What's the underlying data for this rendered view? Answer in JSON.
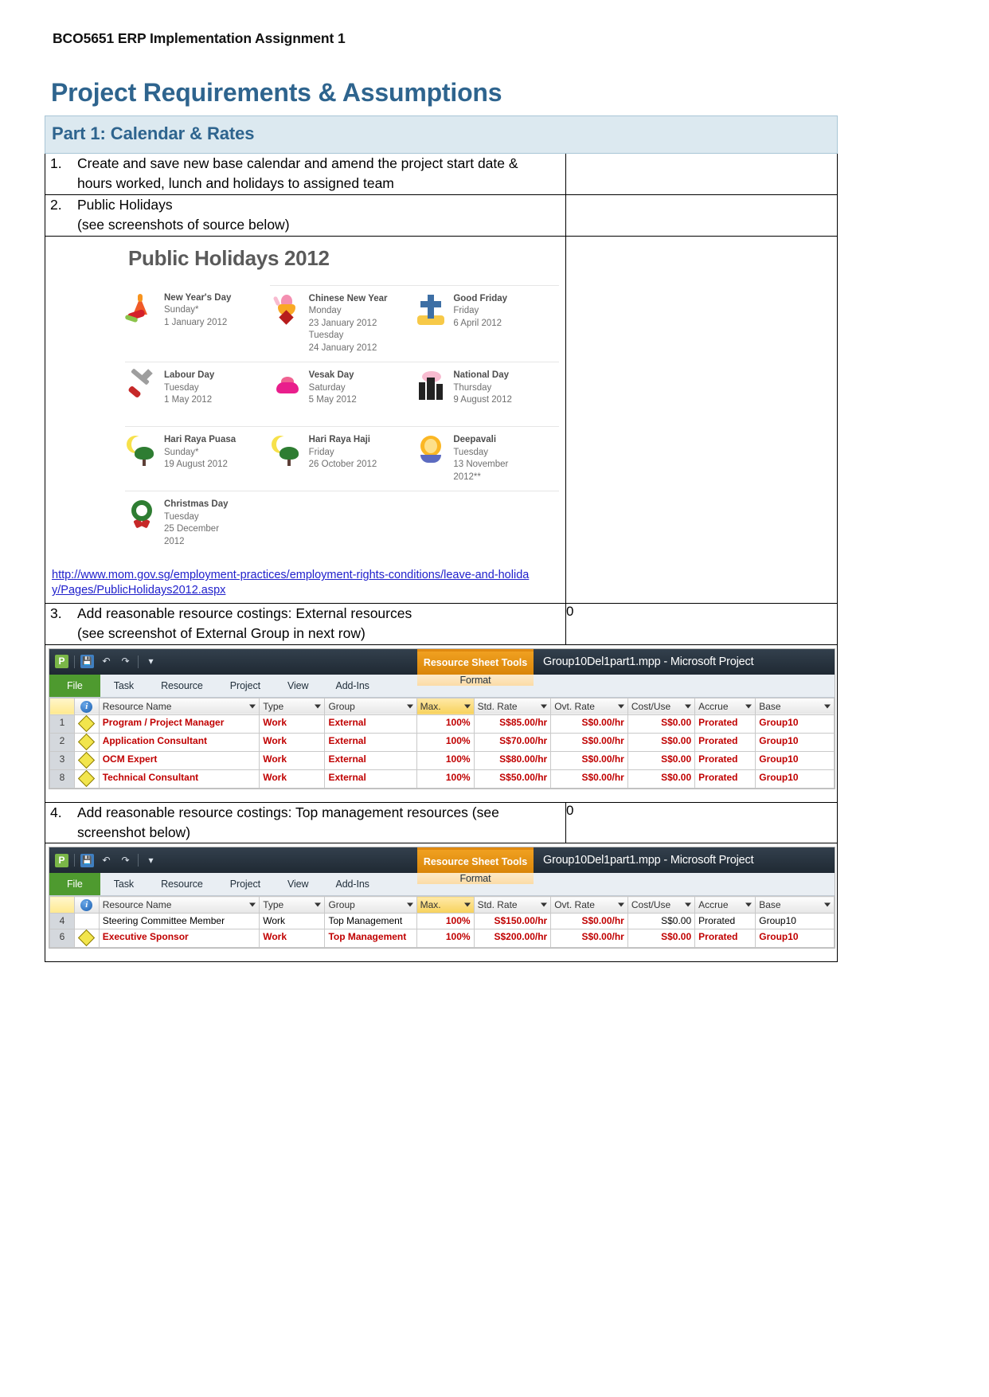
{
  "document": {
    "header": "BCO5651 ERP Implementation Assignment 1",
    "title": "Project Requirements & Assumptions",
    "section_band": "Part 1: Calendar & Rates"
  },
  "requirements": [
    {
      "num": "1.",
      "line1": "Create and save new base calendar and amend the project start date &",
      "line2": "hours worked, lunch and holidays to assigned team",
      "answer": ""
    },
    {
      "num": "2.",
      "line1": "Public Holidays",
      "line2": "(see screenshots of source below)",
      "answer": ""
    },
    {
      "num": "3.",
      "line1": "Add reasonable resource costings: External resources",
      "line2": "(see screenshot of External Group in next row)",
      "answer": "0"
    },
    {
      "num": "4.",
      "line1": "Add reasonable resource costings: Top management resources (see",
      "line2": "screenshot below)",
      "answer": "0"
    }
  ],
  "public_holidays": {
    "heading": "Public Holidays 2012",
    "source_url": "http://www.mom.gov.sg/employment-practices/employment-rights-conditions/leave-and-holiday/Pages/PublicHolidays2012.aspx",
    "items": [
      {
        "name": "New Year's Day",
        "icon": "firecracker-icon",
        "lines": [
          "Sunday*",
          "1 January 2012"
        ]
      },
      {
        "name": "Chinese New Year",
        "icon": "pineapple-icon",
        "lines": [
          "Monday",
          "23 January 2012",
          "Tuesday",
          "24 January 2012"
        ]
      },
      {
        "name": "Good Friday",
        "icon": "cross-icon",
        "lines": [
          "Friday",
          "6 April 2012"
        ]
      },
      {
        "name": "Labour Day",
        "icon": "hammer-icon",
        "lines": [
          "Tuesday",
          "1 May 2012"
        ]
      },
      {
        "name": "Vesak Day",
        "icon": "lotus-icon",
        "lines": [
          "Saturday",
          "5 May 2012"
        ]
      },
      {
        "name": "National Day",
        "icon": "cityscape-icon",
        "lines": [
          "Thursday",
          "9 August 2012"
        ]
      },
      {
        "name": "Hari Raya Puasa",
        "icon": "crescent-icon",
        "lines": [
          "Sunday*",
          "19 August 2012"
        ]
      },
      {
        "name": "Hari Raya Haji",
        "icon": "crescent-icon",
        "lines": [
          "Friday",
          "26 October 2012"
        ]
      },
      {
        "name": "Deepavali",
        "icon": "oil-lamp-icon",
        "lines": [
          "Tuesday",
          "13 November",
          "2012**"
        ]
      },
      {
        "name": "Christmas Day",
        "icon": "wreath-icon",
        "lines": [
          "Tuesday",
          "25 December",
          "2012"
        ]
      }
    ]
  },
  "msproject": {
    "quick_access": [
      "project-logo-icon",
      "save-icon",
      "undo-icon",
      "redo-icon",
      "customize-qat-icon"
    ],
    "context_tab_title": "Resource Sheet Tools",
    "document_title": "Group10Del1part1.mpp  -  Microsoft Project",
    "ribbon_tabs": [
      "File",
      "Task",
      "Resource",
      "Project",
      "View",
      "Add-Ins"
    ],
    "contextual_ribbon_tab": "Format",
    "columns": [
      "Resource Name",
      "Type",
      "Group",
      "Max.",
      "Std. Rate",
      "Ovt. Rate",
      "Cost/Use",
      "Accrue",
      "Base"
    ],
    "external_rows": [
      {
        "id": "1",
        "indicator": "warning-icon",
        "name": "Program / Project Manager",
        "type": "Work",
        "group": "External",
        "max": "100%",
        "std_rate": "S$85.00/hr",
        "ovt_rate": "S$0.00/hr",
        "cost_use": "S$0.00",
        "accrue": "Prorated",
        "base": "Group10"
      },
      {
        "id": "2",
        "indicator": "warning-icon",
        "name": "Application Consultant",
        "type": "Work",
        "group": "External",
        "max": "100%",
        "std_rate": "S$70.00/hr",
        "ovt_rate": "S$0.00/hr",
        "cost_use": "S$0.00",
        "accrue": "Prorated",
        "base": "Group10"
      },
      {
        "id": "3",
        "indicator": "warning-icon",
        "name": "OCM Expert",
        "type": "Work",
        "group": "External",
        "max": "100%",
        "std_rate": "S$80.00/hr",
        "ovt_rate": "S$0.00/hr",
        "cost_use": "S$0.00",
        "accrue": "Prorated",
        "base": "Group10"
      },
      {
        "id": "8",
        "indicator": "warning-icon",
        "name": "Technical Consultant",
        "type": "Work",
        "group": "External",
        "max": "100%",
        "std_rate": "S$50.00/hr",
        "ovt_rate": "S$0.00/hr",
        "cost_use": "S$0.00",
        "accrue": "Prorated",
        "base": "Group10"
      }
    ],
    "topmgmt_rows": [
      {
        "id": "4",
        "indicator": "",
        "name": "Steering Committee Member",
        "type": "Work",
        "group": "Top Management",
        "max": "100%",
        "std_rate": "S$150.00/hr",
        "ovt_rate": "S$0.00/hr",
        "cost_use": "S$0.00",
        "accrue": "Prorated",
        "base": "Group10"
      },
      {
        "id": "6",
        "indicator": "warning-icon",
        "name": "Executive Sponsor",
        "type": "Work",
        "group": "Top Management",
        "max": "100%",
        "std_rate": "S$200.00/hr",
        "ovt_rate": "S$0.00/hr",
        "cost_use": "S$0.00",
        "accrue": "Prorated",
        "base": "Group10"
      }
    ]
  },
  "colors": {
    "heading_blue": "#2e648e",
    "band_bg": "#dce9f0",
    "link_blue": "#2020cc",
    "msp_red": "#c00000",
    "msp_orange": "#e08a10",
    "msp_green": "#4e9a2f"
  }
}
